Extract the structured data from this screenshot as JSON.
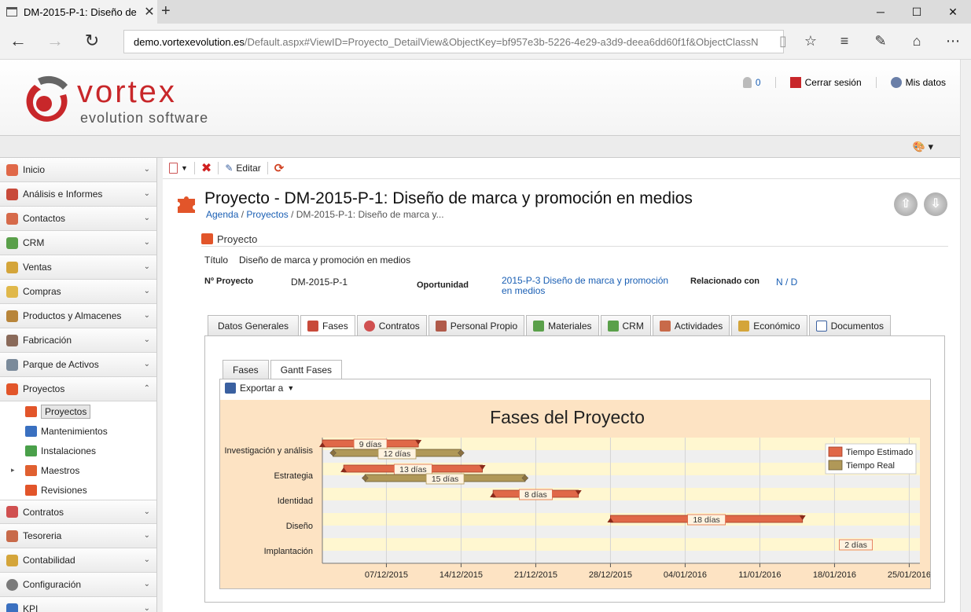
{
  "browser": {
    "tab_title": "DM-2015-P-1: Diseño de",
    "url_host": "demo.vortexevolution.es",
    "url_path": "/Default.aspx#ViewID=Proyecto_DetailView&ObjectKey=bf957e3b-5226-4e29-a3d9-deea6dd60f1f&ObjectClassN"
  },
  "header": {
    "logo_name": "vortex",
    "logo_tag": "evolution software",
    "notif_count": "0",
    "logout": "Cerrar sesión",
    "mydata": "Mis datos"
  },
  "sidebar": {
    "items": [
      "Inicio",
      "Análisis e Informes",
      "Contactos",
      "CRM",
      "Ventas",
      "Compras",
      "Productos y Almacenes",
      "Fabricación",
      "Parque de Activos",
      "Proyectos"
    ],
    "subitems": [
      "Proyectos",
      "Mantenimientos",
      "Instalaciones",
      "Maestros",
      "Revisiones"
    ],
    "items_after": [
      "Contratos",
      "Tesoreria",
      "Contabilidad",
      "Configuración",
      "KPI"
    ]
  },
  "toolbar": {
    "edit": "Editar"
  },
  "page": {
    "title": "Proyecto - DM-2015-P-1: Diseño de marca y promoción en medios",
    "crumb_agenda": "Agenda",
    "crumb_sep1": " / ",
    "crumb_proyectos": "Proyectos",
    "crumb_rest": " / DM-2015-P-1: Diseño de marca y...",
    "section": "Proyecto"
  },
  "fields": {
    "titulo_label": "Título",
    "titulo_value": "Diseño de marca y promoción en medios",
    "nproy_label": "Nº Proyecto",
    "nproy_value": "DM-2015-P-1",
    "oport_label": "Oportunidad",
    "oport_value_1": "2015-P-3 Diseño de marca y promoción",
    "oport_value_2": "en medios",
    "rel_label": "Relacionado con",
    "rel_value": "N / D"
  },
  "tabs": [
    "Datos Generales",
    "Fases",
    "Contratos",
    "Personal Propio",
    "Materiales",
    "CRM",
    "Actividades",
    "Económico",
    "Documentos"
  ],
  "inner_tabs": [
    "Fases",
    "Gantt Fases"
  ],
  "export_label": "Exportar a",
  "colors": {
    "estimated": "#e06848",
    "real": "#b09858",
    "chart_bg": "#fde3c3"
  },
  "chart_data": {
    "type": "bar",
    "title": "Fases del Proyecto",
    "categories": [
      "Investigación y análisis",
      "Estrategia",
      "Identidad",
      "Diseño",
      "Implantación"
    ],
    "x_ticks": [
      "07/12/2015",
      "14/12/2015",
      "21/12/2015",
      "28/12/2015",
      "04/01/2016",
      "11/01/2016",
      "18/01/2016",
      "25/01/2016"
    ],
    "x_range": [
      "2015-12-01",
      "2016-01-26"
    ],
    "legend": {
      "position": "top-right",
      "entries": [
        "Tiempo Estimado",
        "Tiempo Real"
      ]
    },
    "series": [
      {
        "name": "Tiempo Estimado",
        "bars": [
          {
            "cat": 0,
            "start": "2015-12-01",
            "end": "2015-12-10",
            "label": "9 días"
          },
          {
            "cat": 1,
            "start": "2015-12-03",
            "end": "2015-12-16",
            "label": "13 días"
          },
          {
            "cat": 2,
            "start": "2015-12-17",
            "end": "2015-12-25",
            "label": "8 días"
          },
          {
            "cat": 3,
            "start": "2015-12-28",
            "end": "2016-01-15",
            "label": "18 días"
          },
          {
            "cat": 4,
            "start": "2016-01-19",
            "end": "2016-01-21",
            "label": "2 días"
          }
        ]
      },
      {
        "name": "Tiempo Real",
        "bars": [
          {
            "cat": 0,
            "start": "2015-12-02",
            "end": "2015-12-14",
            "label": "12 días"
          },
          {
            "cat": 1,
            "start": "2015-12-05",
            "end": "2015-12-20",
            "label": "15 días"
          }
        ]
      }
    ]
  }
}
